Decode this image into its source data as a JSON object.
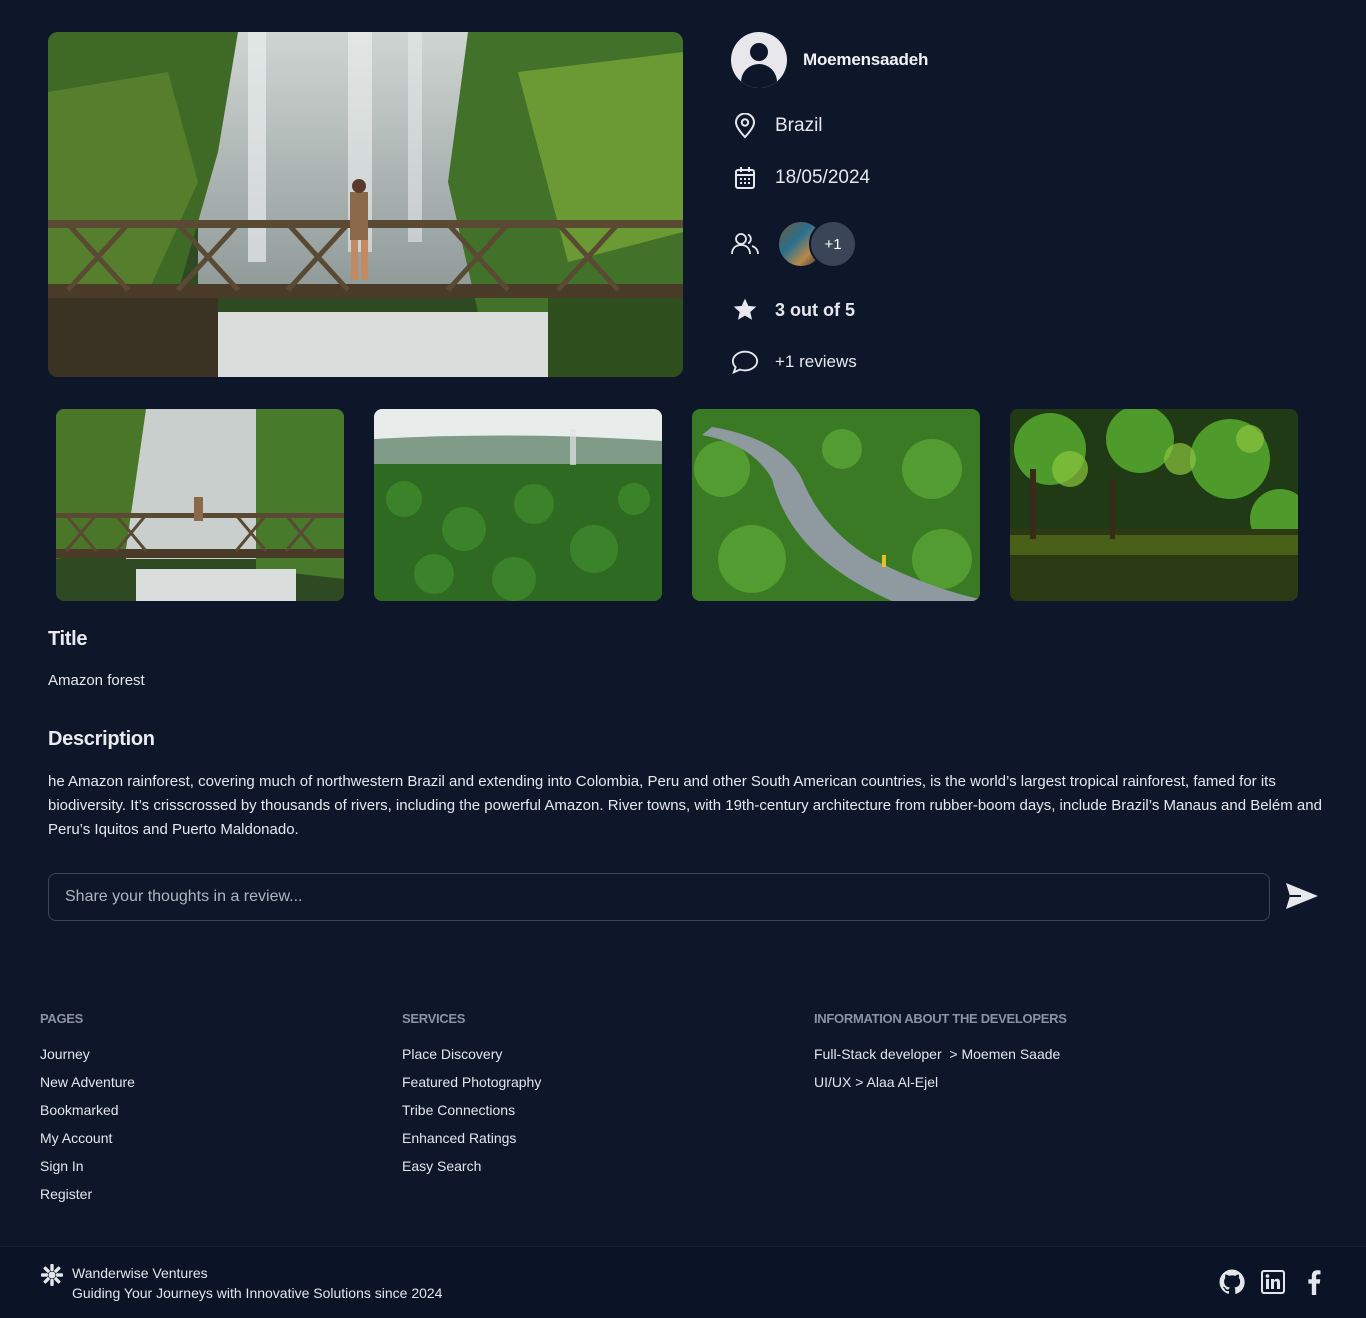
{
  "post": {
    "username": "Moemensaadeh",
    "location": "Brazil",
    "date": "18/05/2024",
    "tribe_more": "+1",
    "rating": "3 out of 5",
    "reviews": "+1 reviews",
    "title_heading": "Title",
    "title": "Amazon forest",
    "description_heading": "Description",
    "description": "he Amazon rainforest, covering much of northwestern Brazil and extending into Colombia, Peru and other South American countries, is the world’s largest tropical rainforest, famed for its biodiversity. It’s crisscrossed by thousands of rivers, including the powerful Amazon. River towns, with 19th-century architecture from rubber-boom days, include Brazil’s Manaus and Belém and Peru’s Iquitos and Puerto Maldonado.",
    "review_placeholder": "Share your thoughts in a review..."
  },
  "icons": {
    "location": "map-pin-icon",
    "date": "calendar-icon",
    "tribe": "users-icon",
    "rating": "star-icon",
    "reviews": "chat-bubble-icon",
    "send": "send-icon"
  },
  "footer": {
    "pages_heading": "PAGES",
    "pages": [
      "Journey",
      "New Adventure",
      "Bookmarked",
      "My Account",
      "Sign In",
      "Register"
    ],
    "services_heading": "SERVICES",
    "services": [
      "Place Discovery",
      "Featured Photography",
      "Tribe Connections",
      "Enhanced Ratings",
      "Easy Search"
    ],
    "developers_heading": "INFORMATION ABOUT THE DEVELOPERS",
    "developers": [
      "Full-Stack developer  > Moemen Saade",
      "UI/UX > Alaa Al-Ejel"
    ],
    "brand_name": "Wanderwise Ventures",
    "brand_tagline": "Guiding Your Journeys with Innovative Solutions since 2024",
    "social": [
      "github-icon",
      "linkedin-icon",
      "facebook-icon"
    ]
  },
  "colors": {
    "background": "#0e172a",
    "text": "#e6e8ee",
    "muted_heading": "#8a92a3",
    "input_border": "#3a4456"
  }
}
